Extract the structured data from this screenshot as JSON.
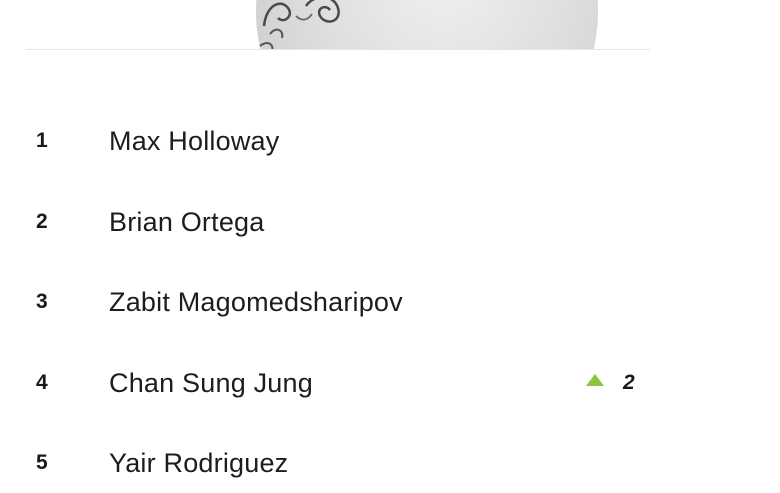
{
  "rankings": [
    {
      "rank": "1",
      "name": "Max Holloway",
      "movement": null
    },
    {
      "rank": "2",
      "name": "Brian Ortega",
      "movement": null
    },
    {
      "rank": "3",
      "name": "Zabit Magomedsharipov",
      "movement": null
    },
    {
      "rank": "4",
      "name": "Chan Sung Jung",
      "movement": {
        "direction": "up",
        "value": "2",
        "icon": "up-arrow-icon",
        "color": "#8cc63f"
      }
    },
    {
      "rank": "5",
      "name": "Yair Rodriguez",
      "movement": null
    }
  ],
  "colors": {
    "text": "#1d1d1d",
    "divider": "#e6e6e6",
    "movement_up": "#8cc63f"
  }
}
